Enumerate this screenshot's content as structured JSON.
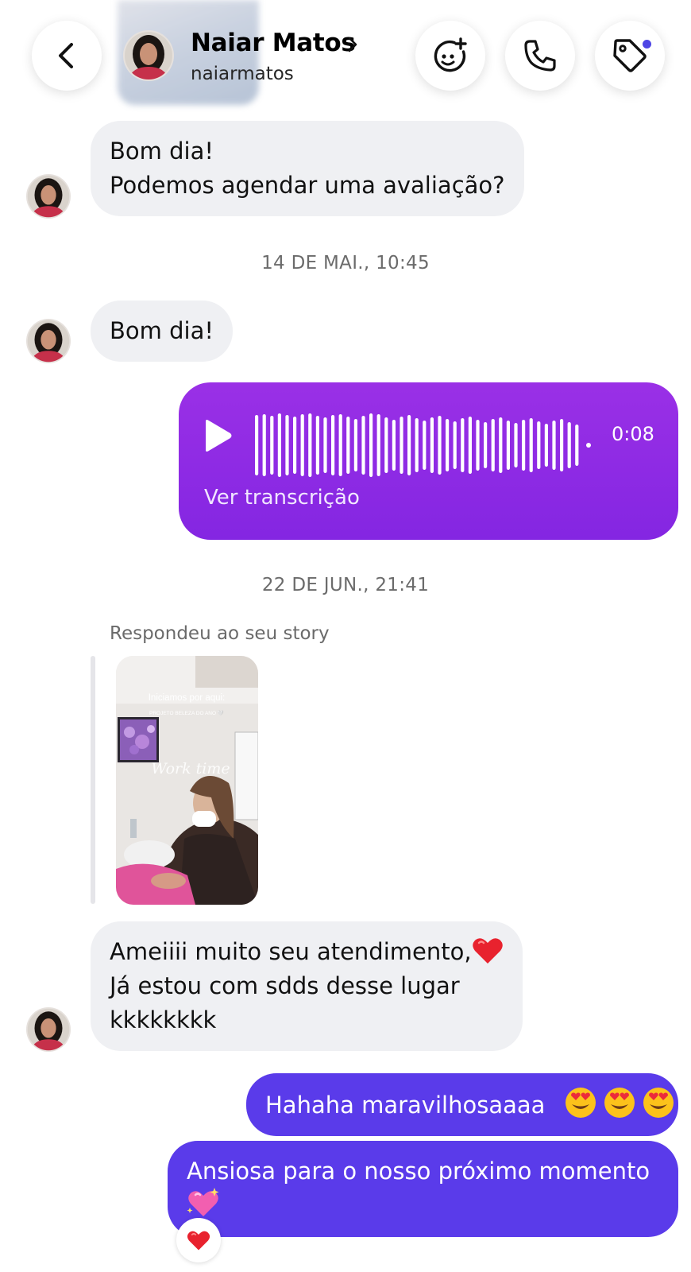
{
  "header": {
    "contact_name": "Naiar Matos",
    "username": "naiarmatos",
    "icons": [
      "back-arrow-icon",
      "effects-icon",
      "phone-icon",
      "tag-icon"
    ],
    "accent_dot_color": "#4f46e5"
  },
  "messages": {
    "m1_line1": "Bom dia!",
    "m1_line2": "Podemos agendar uma avaliação?",
    "timestamp1": "14 DE MAI., 10:45",
    "m2": "Bom dia!",
    "audio_duration": "0:08",
    "audio_transcript_label": "Ver transcrição",
    "timestamp2": "22 DE JUN., 21:41",
    "story_reply_label": "Respondeu ao seu story",
    "m3_line1": "Ameiiii muito seu atendimento,",
    "m3_line2": "Já estou com sdds desse lugar",
    "m3_line3": "kkkkkkkk",
    "m4": "Hahaha maravilhosaaaa",
    "m5": "Ansiosa para o nosso próximo momento"
  },
  "story": {
    "overlay_line1": "Iniciamos por aqui:",
    "overlay_line2": "PROJETO BELEZA DO ANO 🤍",
    "overlay_script": "Work time"
  },
  "colors": {
    "incoming_bubble": "#eff0f3",
    "outgoing_bubble": "#5a3bea",
    "audio_bubble": "#8f2ce4"
  }
}
